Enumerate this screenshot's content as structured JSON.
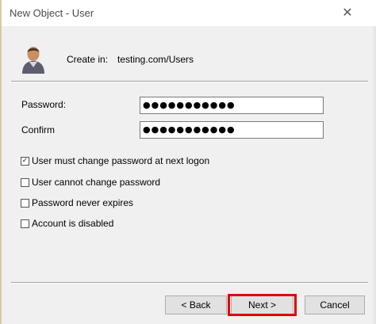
{
  "window": {
    "title": "New Object - User",
    "close_glyph": "✕"
  },
  "header": {
    "icon": "user-icon",
    "create_in_label": "Create in:",
    "create_in_value": "testing.com/Users"
  },
  "fields": {
    "password_label": "Password:",
    "password_value": "●●●●●●●●●●●",
    "confirm_label": "Confirm",
    "confirm_value": "●●●●●●●●●●●"
  },
  "options": [
    {
      "label": "User must change password at next logon",
      "checked": true
    },
    {
      "label": "User cannot change password",
      "checked": false
    },
    {
      "label": "Password never expires",
      "checked": false
    },
    {
      "label": "Account is disabled",
      "checked": false
    }
  ],
  "buttons": {
    "back": "< Back",
    "next": "Next >",
    "cancel": "Cancel"
  },
  "colors": {
    "highlight": "#e00000",
    "dialog_bg": "#f0f0f0"
  }
}
